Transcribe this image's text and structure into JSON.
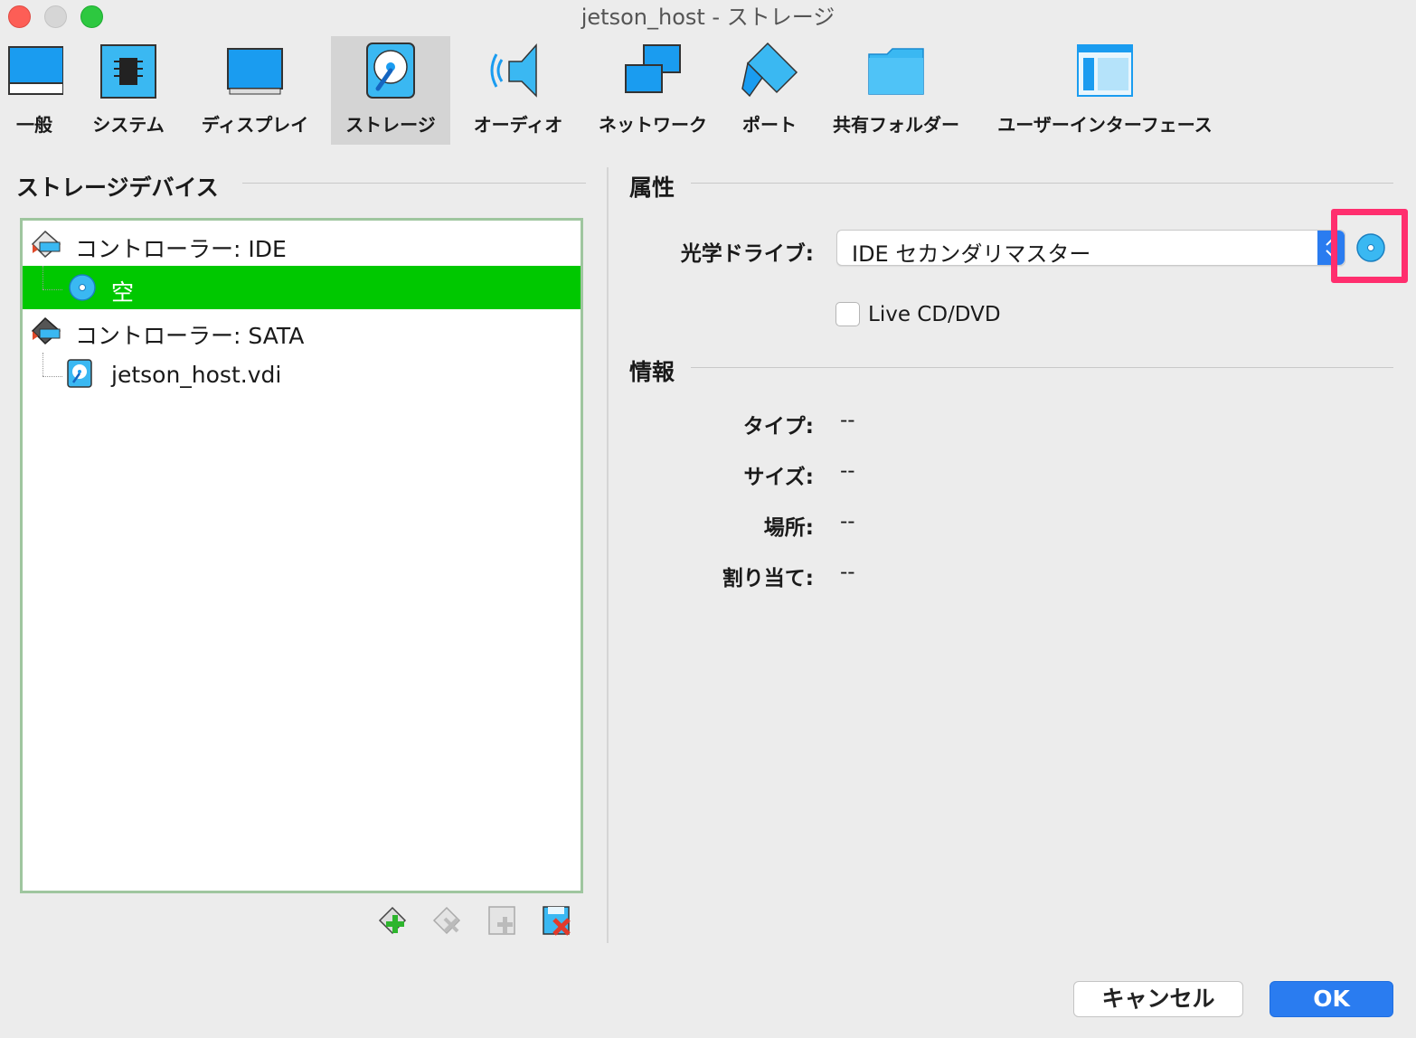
{
  "window": {
    "title": "jetson_host - ストレージ"
  },
  "tabs": [
    {
      "label": "一般",
      "icon": "monitor-icon"
    },
    {
      "label": "システム",
      "icon": "chip-icon"
    },
    {
      "label": "ディスプレイ",
      "icon": "display-icon"
    },
    {
      "label": "ストレージ",
      "icon": "storage-icon"
    },
    {
      "label": "オーディオ",
      "icon": "speaker-icon"
    },
    {
      "label": "ネットワーク",
      "icon": "network-icon"
    },
    {
      "label": "ポート",
      "icon": "port-icon"
    },
    {
      "label": "共有フォルダー",
      "icon": "folder-icon"
    },
    {
      "label": "ユーザーインターフェース",
      "icon": "ui-window-icon"
    }
  ],
  "active_tab": "ストレージ",
  "storage_devices": {
    "title": "ストレージデバイス",
    "tree": [
      {
        "label": "コントローラー: IDE",
        "type": "controller",
        "icon": "ide-controller-icon"
      },
      {
        "label": "空",
        "type": "optical",
        "icon": "optical-disc-icon",
        "selected": true
      },
      {
        "label": "コントローラー: SATA",
        "type": "controller",
        "icon": "sata-controller-icon"
      },
      {
        "label": "jetson_host.vdi",
        "type": "disk",
        "icon": "hard-disk-icon"
      }
    ],
    "toolbar": [
      "add-controller-icon",
      "remove-controller-icon",
      "add-attachment-icon",
      "remove-attachment-icon"
    ]
  },
  "attributes": {
    "title": "属性",
    "optical_drive_label": "光学ドライブ:",
    "optical_drive_value": "IDE セカンダリマスター",
    "live_cd_label": "Live CD/DVD",
    "live_cd_checked": false
  },
  "info": {
    "title": "情報",
    "rows": [
      {
        "label": "タイプ:",
        "value": "--"
      },
      {
        "label": "サイズ:",
        "value": "--"
      },
      {
        "label": "場所:",
        "value": "--"
      },
      {
        "label": "割り当て:",
        "value": "--"
      }
    ]
  },
  "buttons": {
    "cancel": "キャンセル",
    "ok": "OK"
  },
  "colors": {
    "selection": "#00c800",
    "accent": "#2a7cf0",
    "highlight": "#ff2e6e"
  }
}
